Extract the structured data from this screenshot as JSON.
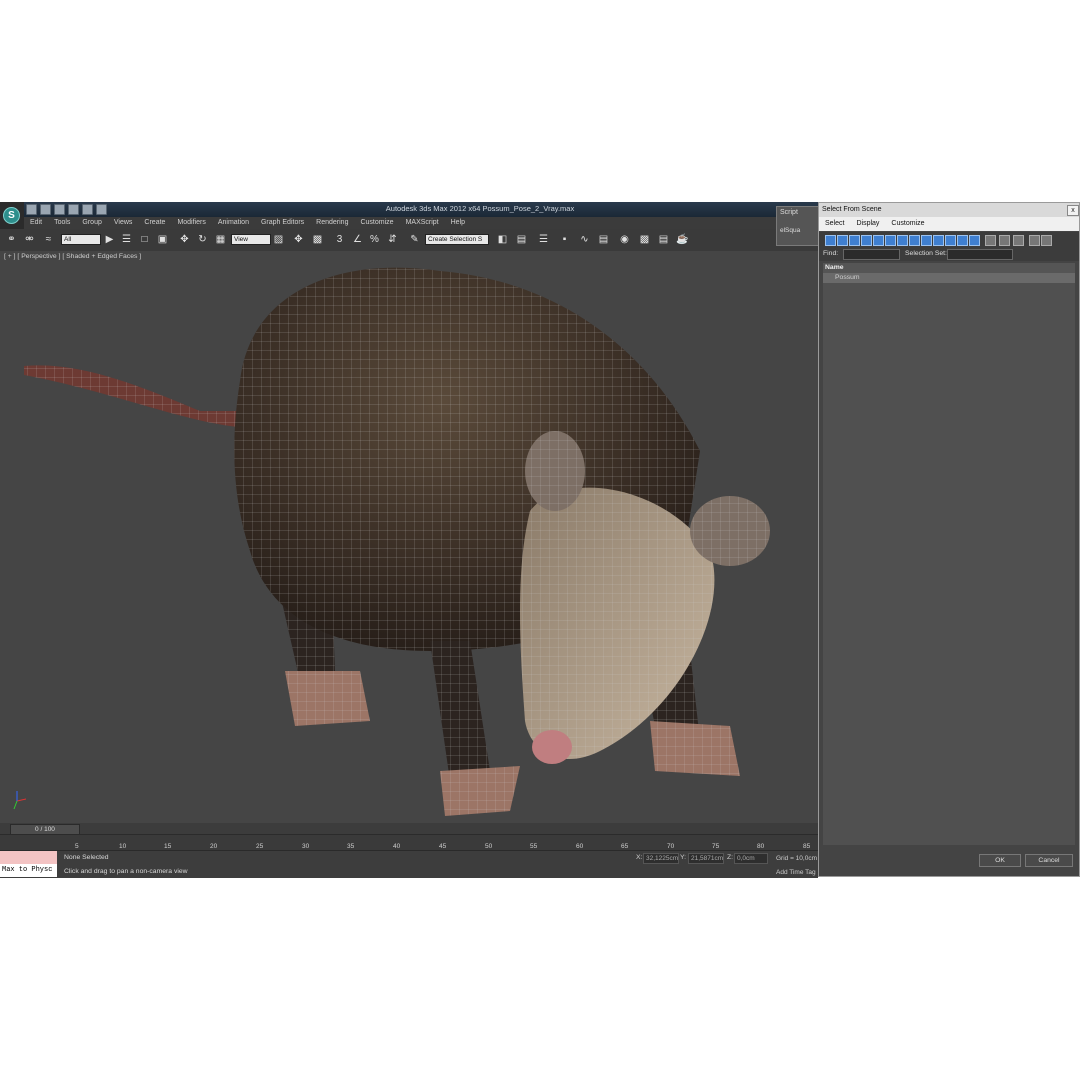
{
  "titlebar": {
    "title": "Autodesk 3ds Max  2012 x64      Possum_Pose_2_Vray.max"
  },
  "menu": [
    "Edit",
    "Tools",
    "Group",
    "Views",
    "Create",
    "Modifiers",
    "Animation",
    "Graph Editors",
    "Rendering",
    "Customize",
    "MAXScript",
    "Help"
  ],
  "toolbar": {
    "filter_value": "All",
    "coord_system": "View",
    "named_selection": "Create Selection S"
  },
  "viewport": {
    "label": "[ + ] [ Perspective ] [ Shaded + Edged Faces ]",
    "subject_icon": "possum-wireframe-model"
  },
  "timeline": {
    "frame_display": "0 / 100",
    "ticks": [
      "5",
      "10",
      "15",
      "20",
      "25",
      "30",
      "35",
      "40",
      "45",
      "50",
      "55",
      "60",
      "65",
      "70",
      "75",
      "80",
      "85"
    ]
  },
  "status": {
    "maxscript_input": "Max to Physc",
    "selection": "None Selected",
    "prompt": "Click and drag to pan a non-camera view",
    "x_label": "X:",
    "x_value": "32,1225cm",
    "y_label": "Y:",
    "y_value": "21,5871cm",
    "z_label": "Z:",
    "z_value": "0,0cm",
    "grid": "Grid = 10,0cm",
    "add_time_tag": "Add Time Tag"
  },
  "script_panel": {
    "title": "Script",
    "item": "elSqua"
  },
  "dialog": {
    "title": "Select From Scene",
    "close_label": "x",
    "menu": [
      "Select",
      "Display",
      "Customize"
    ],
    "find_label": "Find:",
    "selection_set_label": "Selection Set:",
    "column_header": "Name",
    "items": [
      "Possum"
    ],
    "ok_label": "OK",
    "cancel_label": "Cancel"
  }
}
